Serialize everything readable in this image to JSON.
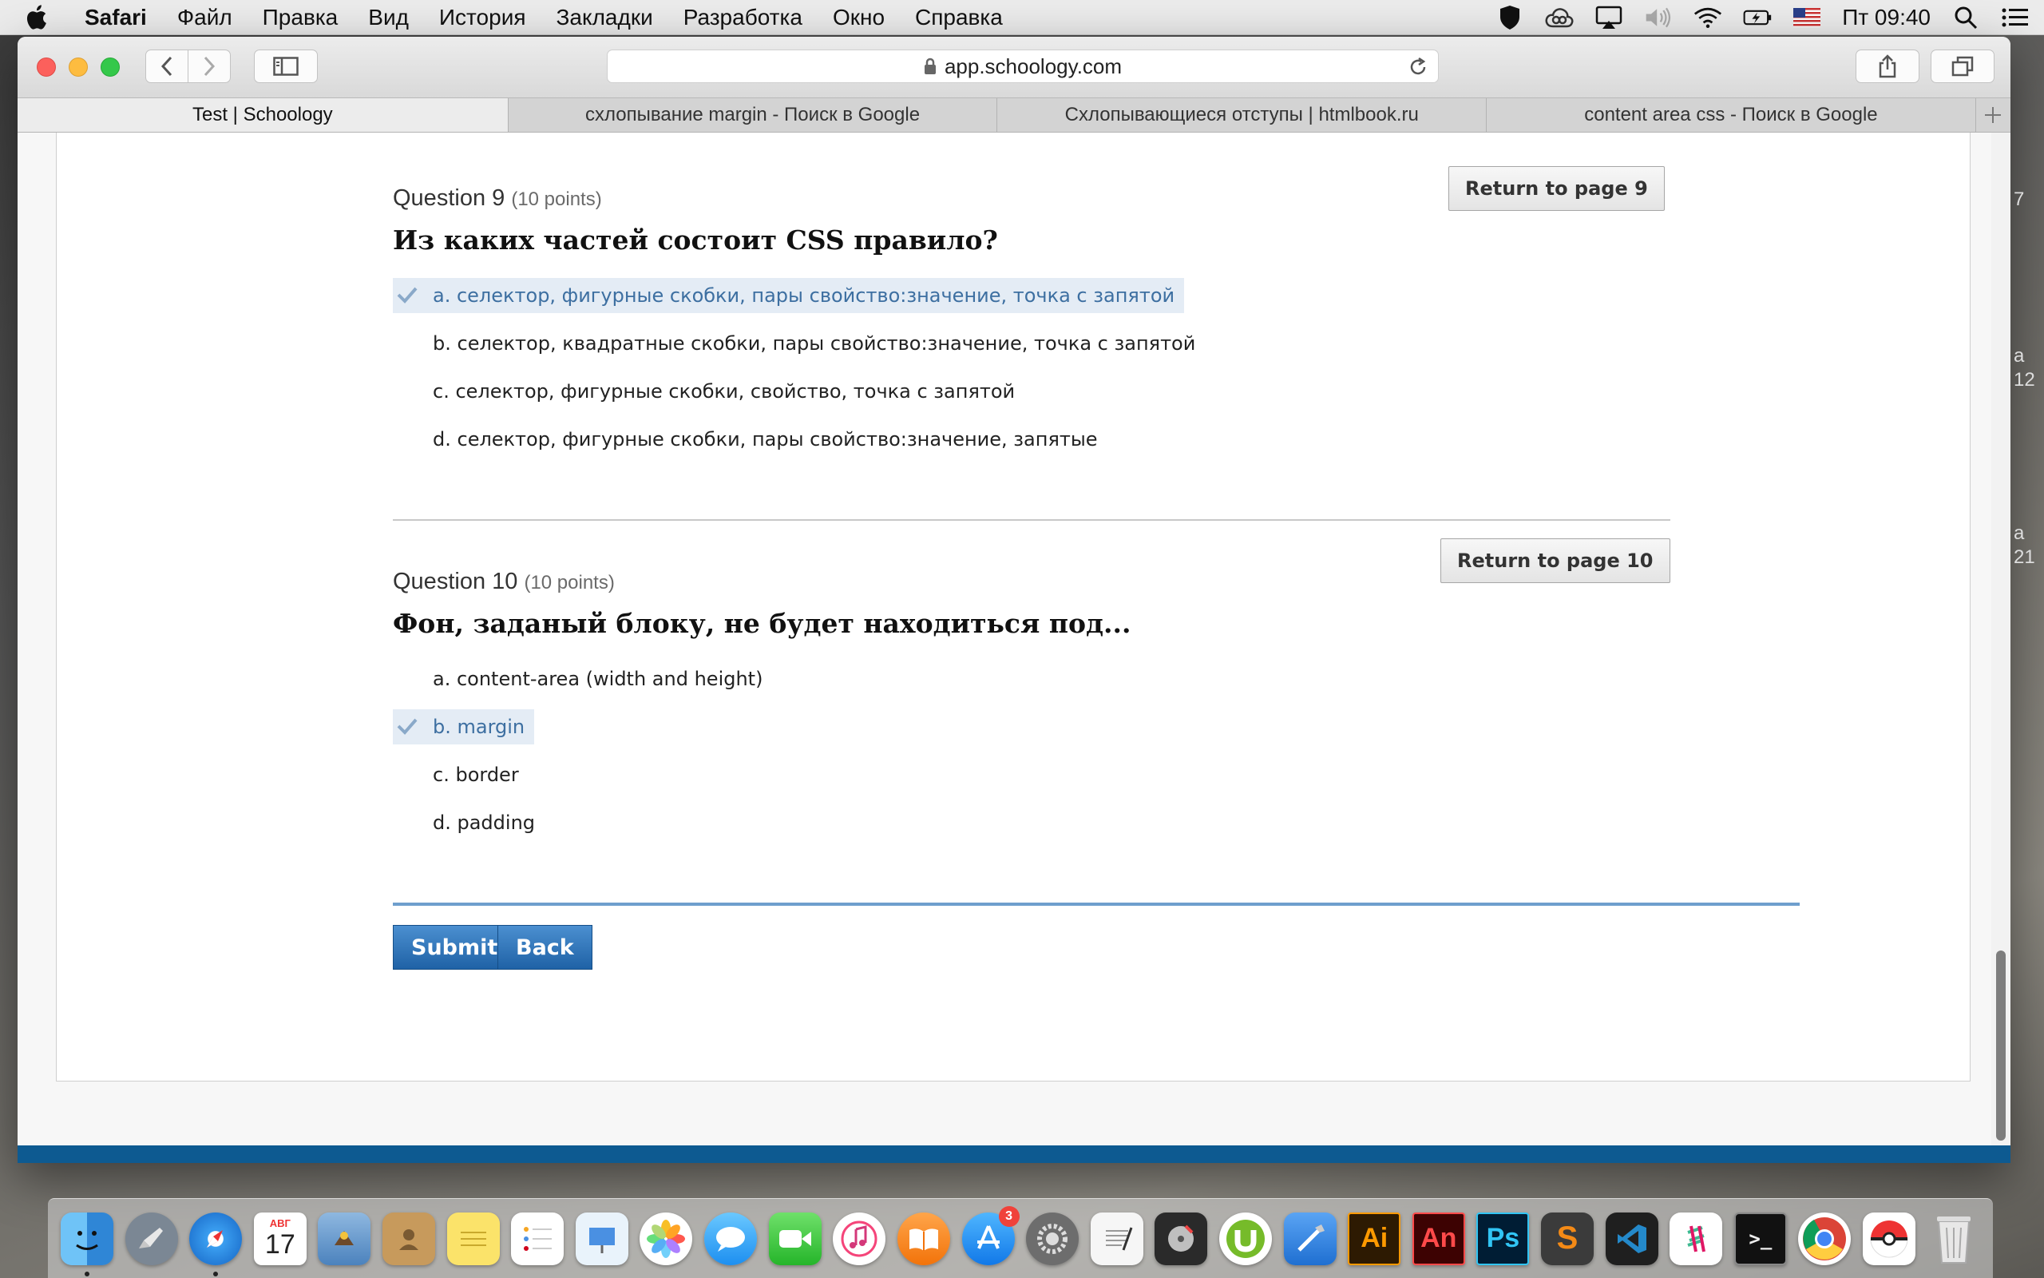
{
  "menubar": {
    "app_name": "Safari",
    "items": [
      "Файл",
      "Правка",
      "Вид",
      "История",
      "Закладки",
      "Разработка",
      "Окно",
      "Справка"
    ],
    "clock": "Пт 09:40"
  },
  "browser": {
    "address": "app.schoology.com",
    "tabs": [
      {
        "title": "Test | Schoology"
      },
      {
        "title": "схлопывание margin - Поиск в Google"
      },
      {
        "title": "Схлопывающиеся отступы | htmlbook.ru"
      },
      {
        "title": "content area css - Поиск в Google"
      }
    ]
  },
  "questions": [
    {
      "label": "Question 9",
      "points": "(10 points)",
      "title": "Из каких частей состоит CSS правило?",
      "return_label": "Return to page 9",
      "options": [
        {
          "text": "a. селектор, фигурные скобки, пары свойство:значение, точка с запятой",
          "selected": true
        },
        {
          "text": "b. селектор, квадратные скобки, пары свойство:значение, точка с запятой",
          "selected": false
        },
        {
          "text": "c. селектор, фигурные скобки, свойство, точка с запятой",
          "selected": false
        },
        {
          "text": "d. селектор, фигурные скобки, пары свойство:значение, запятые",
          "selected": false
        }
      ]
    },
    {
      "label": "Question 10",
      "points": "(10 points)",
      "title": "Фон, заданый блоку, не будет находиться под...",
      "return_label": "Return to page 10",
      "options": [
        {
          "text": "a. content-area (width and height)",
          "selected": false
        },
        {
          "text": "b. margin",
          "selected": true
        },
        {
          "text": "c. border",
          "selected": false
        },
        {
          "text": "d. padding",
          "selected": false
        }
      ]
    }
  ],
  "actions": {
    "submit_label": "Submit",
    "back_label": "Back"
  },
  "desktop_peek": [
    "7",
    "a",
    "12",
    "a",
    "21"
  ],
  "dock": {
    "calendar_month": "АВГ",
    "calendar_day": "17",
    "appstore_badge": "3",
    "illustrator_label": "Ai",
    "animate_label": "An",
    "photoshop_label": "Ps",
    "sublime_label": "S",
    "terminal_label": ">_"
  }
}
